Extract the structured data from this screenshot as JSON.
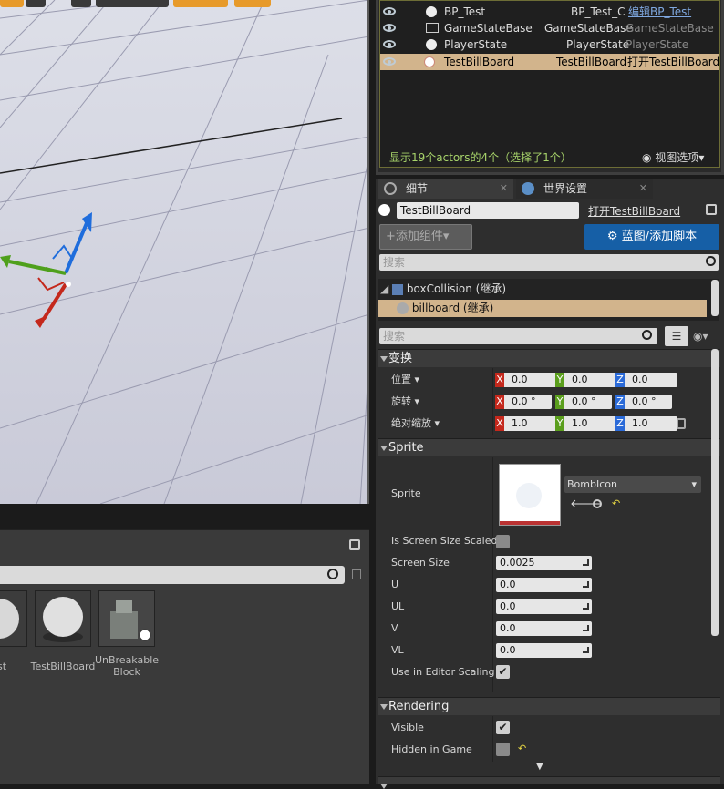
{
  "outliner": {
    "rows": [
      {
        "name": "BP_Test",
        "type": "BP_Test_C",
        "action": "编辑BP_Test",
        "selected": false
      },
      {
        "name": "GameStateBase",
        "type": "GameStateBase",
        "action": "GameStateBase",
        "selected": false
      },
      {
        "name": "PlayerState",
        "type": "PlayerState",
        "action": "PlayerState",
        "selected": false
      },
      {
        "name": "TestBillBoard",
        "type": "TestBillBoard",
        "action": "打开TestBillBoard",
        "selected": true
      }
    ],
    "status": "显示19个actors的4个（选择了1个）",
    "view_options": "视图选项"
  },
  "details": {
    "tabs": [
      {
        "label": "细节"
      },
      {
        "label": "世界设置"
      }
    ],
    "actor_name": "TestBillBoard",
    "open_link": "打开TestBillBoard",
    "add_component": "添加组件",
    "blueprint_button": "蓝图/添加脚本",
    "search_placeholder": "搜索",
    "components": [
      {
        "label": "boxCollision (继承)"
      },
      {
        "label": "billboard (继承)"
      }
    ],
    "filter_placeholder": "搜索",
    "transform": {
      "title": "变换",
      "location": {
        "label": "位置",
        "x": "0.0",
        "y": "0.0",
        "z": "0.0"
      },
      "rotation": {
        "label": "旋转",
        "x": "0.0 °",
        "y": "0.0 °",
        "z": "0.0 °"
      },
      "scale": {
        "label": "绝对缩放",
        "x": "1.0",
        "y": "1.0",
        "z": "1.0"
      }
    },
    "sprite": {
      "title": "Sprite",
      "sprite_label": "Sprite",
      "asset": "BombIcon",
      "is_screen_size_scaled": "Is Screen Size Scaled",
      "screen_size_label": "Screen Size",
      "screen_size": "0.0025",
      "u_label": "U",
      "u": "0.0",
      "ul_label": "UL",
      "ul": "0.0",
      "v_label": "V",
      "v": "0.0",
      "vl_label": "VL",
      "vl": "0.0",
      "editor_scaling_label": "Use in Editor Scaling"
    },
    "rendering": {
      "title": "Rendering",
      "visible_label": "Visible",
      "hidden_label": "Hidden in Game"
    }
  },
  "content_browser": {
    "search_placeholder": "",
    "assets": [
      {
        "label": "st"
      },
      {
        "label": "TestBillBoard"
      },
      {
        "label": "UnBreakable Block"
      }
    ]
  },
  "colors": {
    "accent_blue": "#165fa6",
    "selection": "#d2b48c",
    "axis_x": "#c4281c",
    "axis_y": "#5a9e1c",
    "axis_z": "#2a6ad8"
  }
}
